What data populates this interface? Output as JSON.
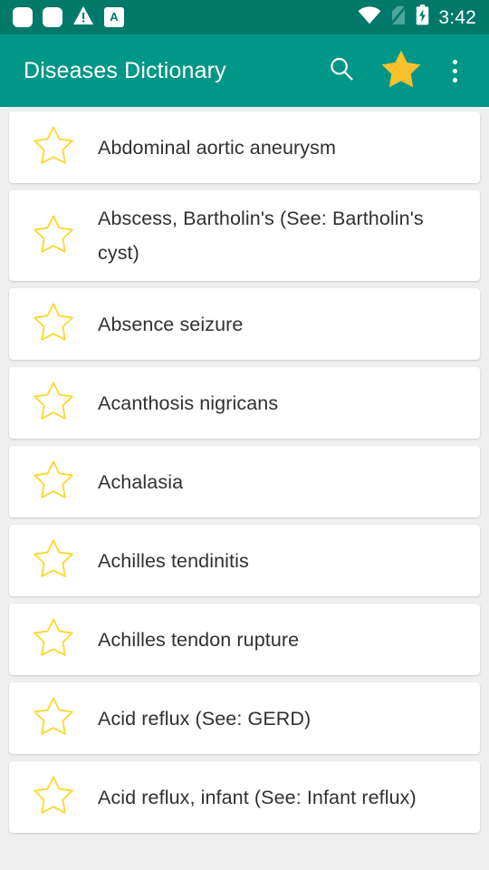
{
  "status_bar": {
    "icons_left": [
      "notification-square",
      "notification-square",
      "warning-triangle-icon",
      "keyboard-language-icon"
    ],
    "keyboard_letter": "A",
    "icons_right": [
      "wifi-icon",
      "no-sim-icon",
      "battery-charging-icon"
    ],
    "time": "3:42",
    "background_color": "#00796b"
  },
  "toolbar": {
    "title": "Diseases Dictionary",
    "search_label": "search-icon",
    "favorites_label": "star-filled-icon",
    "overflow_label": "more-options-icon",
    "background_color": "#009688",
    "title_color": "#ffffff",
    "star_color": "#fbc02d"
  },
  "list": {
    "star_outline_color": "#fdd835",
    "text_color": "#303030",
    "card_background": "#ffffff",
    "page_background": "#efefef",
    "items": [
      {
        "label": "Abdominal aortic aneurysm",
        "favorited": false
      },
      {
        "label": "Abscess, Bartholin's (See: Bartholin's cyst)",
        "favorited": false
      },
      {
        "label": "Absence seizure",
        "favorited": false
      },
      {
        "label": "Acanthosis nigricans",
        "favorited": false
      },
      {
        "label": "Achalasia",
        "favorited": false
      },
      {
        "label": "Achilles tendinitis",
        "favorited": false
      },
      {
        "label": "Achilles tendon rupture",
        "favorited": false
      },
      {
        "label": "Acid reflux (See: GERD)",
        "favorited": false
      },
      {
        "label": "Acid reflux, infant (See: Infant reflux)",
        "favorited": false
      }
    ]
  }
}
